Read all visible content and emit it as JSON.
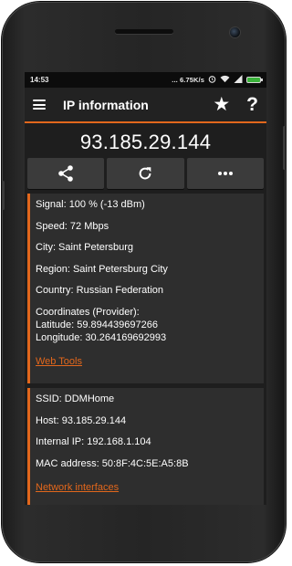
{
  "status_bar": {
    "time": "14:53",
    "network_speed": "... 6.75K/s",
    "battery_color": "#3ab23a"
  },
  "toolbar": {
    "title": "IP information",
    "accent_color": "#e2671c"
  },
  "ip_address": "93.185.29.144",
  "actions": [
    {
      "icon": "share-icon"
    },
    {
      "icon": "refresh-icon"
    },
    {
      "icon": "more-icon"
    }
  ],
  "location_card": {
    "signal": "Signal: 100 % (-13 dBm)",
    "speed": "Speed: 72 Mbps",
    "city": "City: Saint Petersburg",
    "region": "Region: Saint Petersburg City",
    "country": "Country: Russian Federation",
    "coordinates_label": "Coordinates (Provider):",
    "latitude": "Latitude: 59.894439697266",
    "longitude": "Longitude: 30.264169692993",
    "link": "Web Tools"
  },
  "network_card": {
    "ssid": "SSID: DDMHome",
    "host": "Host: 93.185.29.144",
    "internal_ip": "Internal IP: 192.168.1.104",
    "mac": "MAC address: 50:8F:4C:5E:A5:8B",
    "link": "Network interfaces"
  }
}
